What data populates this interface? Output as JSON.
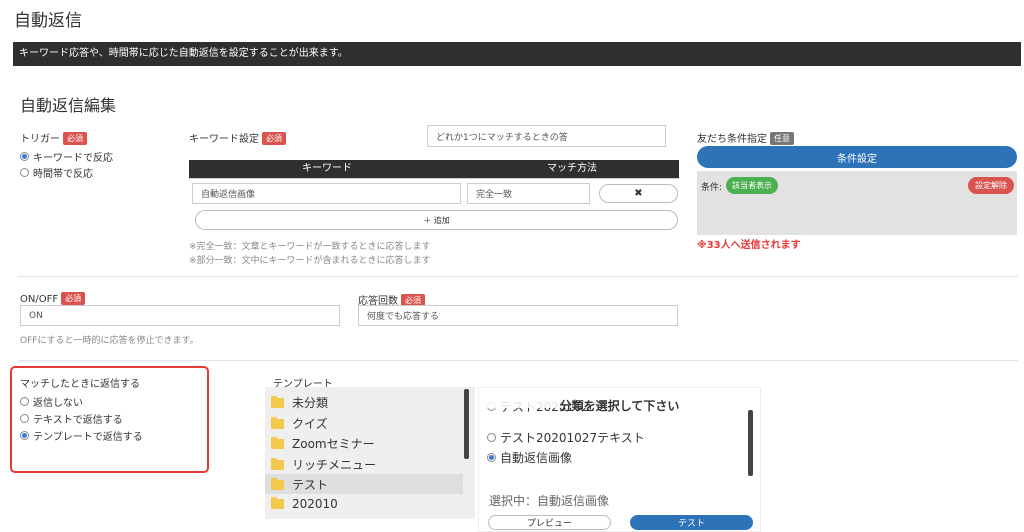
{
  "page": {
    "title": "自動返信",
    "banner": "キーワード応答や、時間帯に応じた自動返信を設定することが出来ます。",
    "section_title": "自動返信編集"
  },
  "trigger": {
    "label": "トリガー",
    "required": "必須",
    "options": [
      {
        "label": "キーワードで反応",
        "selected": true
      },
      {
        "label": "時間帯で反応",
        "selected": false
      }
    ]
  },
  "keyword": {
    "label": "キーワード設定",
    "required": "必須",
    "match_select": "どれか1つにマッチするときの答",
    "col_keyword": "キーワード",
    "col_match": "マッチ方法",
    "row_keyword": "自動返信画像",
    "row_match": "完全一致",
    "delete_icon": "✖",
    "add_label": "＋ 追加",
    "note1": "※完全一致：文章とキーワードが一致するときに応答します",
    "note2": "※部分一致：文中にキーワードが含まれるときに応答します"
  },
  "friend_condition": {
    "label": "友だち条件指定",
    "optional": "任意",
    "set_button": "条件設定",
    "cond_label": "条件:",
    "show_button": "該当者表示",
    "clear_button": "設定解除",
    "send_count": "※33人へ送信されます"
  },
  "onoff": {
    "label": "ON/OFF",
    "required": "必須",
    "value": "ON",
    "note": "OFFにすると一時的に応答を停止できます。"
  },
  "response_count": {
    "label": "応答回数",
    "required": "必須",
    "value": "何度でも応答する"
  },
  "reply_method": {
    "label": "マッチしたときに返信する",
    "options": [
      {
        "label": "返信しない",
        "selected": false
      },
      {
        "label": "テキストで返信する",
        "selected": false
      },
      {
        "label": "テンプレートで返信する",
        "selected": true
      }
    ]
  },
  "template": {
    "label": "テンプレート",
    "folders": [
      "未分類",
      "クイズ",
      "Zoomセミナー",
      "リッチメニュー",
      "テスト",
      "202010"
    ],
    "selected_folder": "テスト",
    "header": "分類を選択して下さい",
    "items": [
      {
        "label": "テスト20201027",
        "selected": false
      },
      {
        "label": "テスト20201027テキスト",
        "selected": false
      },
      {
        "label": "自動返信画像",
        "selected": true
      }
    ],
    "selected_text": "選択中：自動返信画像",
    "preview_button": "プレビュー",
    "test_button": "テスト"
  },
  "colors": {
    "banner_bg": "#2f2f2f",
    "required_badge": "#d9534f",
    "primary_blue": "#2e72b8",
    "highlight_red": "#e53935",
    "success_green": "#4caf50"
  }
}
